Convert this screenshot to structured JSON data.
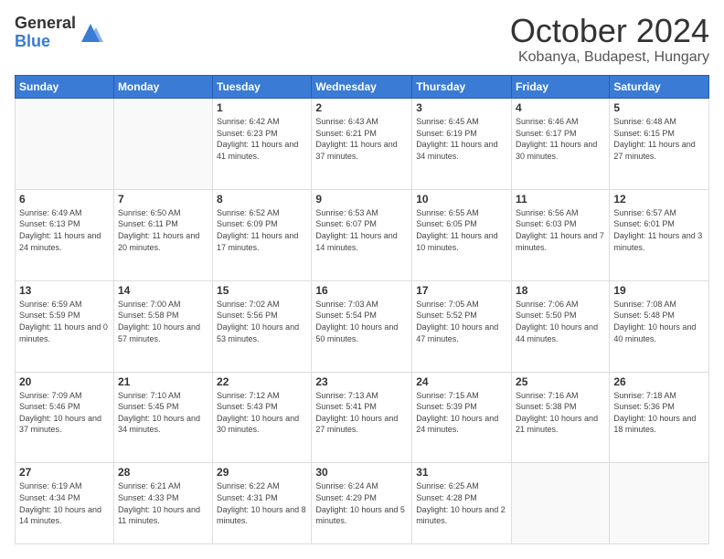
{
  "logo": {
    "general": "General",
    "blue": "Blue"
  },
  "title": "October 2024",
  "location": "Kobanya, Budapest, Hungary",
  "weekdays": [
    "Sunday",
    "Monday",
    "Tuesday",
    "Wednesday",
    "Thursday",
    "Friday",
    "Saturday"
  ],
  "weeks": [
    [
      {
        "day": "",
        "info": ""
      },
      {
        "day": "",
        "info": ""
      },
      {
        "day": "1",
        "info": "Sunrise: 6:42 AM\nSunset: 6:23 PM\nDaylight: 11 hours and 41 minutes."
      },
      {
        "day": "2",
        "info": "Sunrise: 6:43 AM\nSunset: 6:21 PM\nDaylight: 11 hours and 37 minutes."
      },
      {
        "day": "3",
        "info": "Sunrise: 6:45 AM\nSunset: 6:19 PM\nDaylight: 11 hours and 34 minutes."
      },
      {
        "day": "4",
        "info": "Sunrise: 6:46 AM\nSunset: 6:17 PM\nDaylight: 11 hours and 30 minutes."
      },
      {
        "day": "5",
        "info": "Sunrise: 6:48 AM\nSunset: 6:15 PM\nDaylight: 11 hours and 27 minutes."
      }
    ],
    [
      {
        "day": "6",
        "info": "Sunrise: 6:49 AM\nSunset: 6:13 PM\nDaylight: 11 hours and 24 minutes."
      },
      {
        "day": "7",
        "info": "Sunrise: 6:50 AM\nSunset: 6:11 PM\nDaylight: 11 hours and 20 minutes."
      },
      {
        "day": "8",
        "info": "Sunrise: 6:52 AM\nSunset: 6:09 PM\nDaylight: 11 hours and 17 minutes."
      },
      {
        "day": "9",
        "info": "Sunrise: 6:53 AM\nSunset: 6:07 PM\nDaylight: 11 hours and 14 minutes."
      },
      {
        "day": "10",
        "info": "Sunrise: 6:55 AM\nSunset: 6:05 PM\nDaylight: 11 hours and 10 minutes."
      },
      {
        "day": "11",
        "info": "Sunrise: 6:56 AM\nSunset: 6:03 PM\nDaylight: 11 hours and 7 minutes."
      },
      {
        "day": "12",
        "info": "Sunrise: 6:57 AM\nSunset: 6:01 PM\nDaylight: 11 hours and 3 minutes."
      }
    ],
    [
      {
        "day": "13",
        "info": "Sunrise: 6:59 AM\nSunset: 5:59 PM\nDaylight: 11 hours and 0 minutes."
      },
      {
        "day": "14",
        "info": "Sunrise: 7:00 AM\nSunset: 5:58 PM\nDaylight: 10 hours and 57 minutes."
      },
      {
        "day": "15",
        "info": "Sunrise: 7:02 AM\nSunset: 5:56 PM\nDaylight: 10 hours and 53 minutes."
      },
      {
        "day": "16",
        "info": "Sunrise: 7:03 AM\nSunset: 5:54 PM\nDaylight: 10 hours and 50 minutes."
      },
      {
        "day": "17",
        "info": "Sunrise: 7:05 AM\nSunset: 5:52 PM\nDaylight: 10 hours and 47 minutes."
      },
      {
        "day": "18",
        "info": "Sunrise: 7:06 AM\nSunset: 5:50 PM\nDaylight: 10 hours and 44 minutes."
      },
      {
        "day": "19",
        "info": "Sunrise: 7:08 AM\nSunset: 5:48 PM\nDaylight: 10 hours and 40 minutes."
      }
    ],
    [
      {
        "day": "20",
        "info": "Sunrise: 7:09 AM\nSunset: 5:46 PM\nDaylight: 10 hours and 37 minutes."
      },
      {
        "day": "21",
        "info": "Sunrise: 7:10 AM\nSunset: 5:45 PM\nDaylight: 10 hours and 34 minutes."
      },
      {
        "day": "22",
        "info": "Sunrise: 7:12 AM\nSunset: 5:43 PM\nDaylight: 10 hours and 30 minutes."
      },
      {
        "day": "23",
        "info": "Sunrise: 7:13 AM\nSunset: 5:41 PM\nDaylight: 10 hours and 27 minutes."
      },
      {
        "day": "24",
        "info": "Sunrise: 7:15 AM\nSunset: 5:39 PM\nDaylight: 10 hours and 24 minutes."
      },
      {
        "day": "25",
        "info": "Sunrise: 7:16 AM\nSunset: 5:38 PM\nDaylight: 10 hours and 21 minutes."
      },
      {
        "day": "26",
        "info": "Sunrise: 7:18 AM\nSunset: 5:36 PM\nDaylight: 10 hours and 18 minutes."
      }
    ],
    [
      {
        "day": "27",
        "info": "Sunrise: 6:19 AM\nSunset: 4:34 PM\nDaylight: 10 hours and 14 minutes."
      },
      {
        "day": "28",
        "info": "Sunrise: 6:21 AM\nSunset: 4:33 PM\nDaylight: 10 hours and 11 minutes."
      },
      {
        "day": "29",
        "info": "Sunrise: 6:22 AM\nSunset: 4:31 PM\nDaylight: 10 hours and 8 minutes."
      },
      {
        "day": "30",
        "info": "Sunrise: 6:24 AM\nSunset: 4:29 PM\nDaylight: 10 hours and 5 minutes."
      },
      {
        "day": "31",
        "info": "Sunrise: 6:25 AM\nSunset: 4:28 PM\nDaylight: 10 hours and 2 minutes."
      },
      {
        "day": "",
        "info": ""
      },
      {
        "day": "",
        "info": ""
      }
    ]
  ]
}
